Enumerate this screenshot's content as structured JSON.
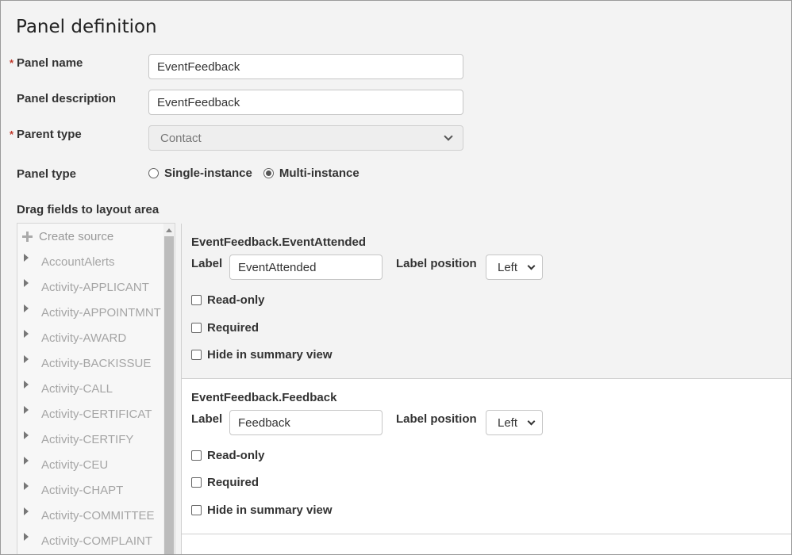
{
  "page": {
    "title": "Panel definition"
  },
  "form": {
    "panel_name": {
      "label": "Panel name",
      "value": "EventFeedback"
    },
    "panel_description": {
      "label": "Panel description",
      "value": "EventFeedback"
    },
    "parent_type": {
      "label": "Parent type",
      "value": "Contact"
    },
    "panel_type": {
      "label": "Panel type",
      "options": [
        {
          "label": "Single-instance",
          "selected": false
        },
        {
          "label": "Multi-instance",
          "selected": true
        }
      ]
    },
    "required_marker": "*"
  },
  "sources": {
    "heading": "Drag fields to layout area",
    "create_label": "Create source",
    "items": [
      "AccountAlerts",
      "Activity-APPLICANT",
      "Activity-APPOINTMNT",
      "Activity-AWARD",
      "Activity-BACKISSUE",
      "Activity-CALL",
      "Activity-CERTIFICAT",
      "Activity-CERTIFY",
      "Activity-CEU",
      "Activity-CHAPT",
      "Activity-COMMITTEE",
      "Activity-COMPLAINT"
    ]
  },
  "layout_fields": [
    {
      "title": "EventFeedback.EventAttended",
      "label_caption": "Label",
      "label_value": "EventAttended",
      "position_caption": "Label position",
      "position_value": "Left",
      "read_only": "Read-only",
      "required": "Required",
      "hide_summary": "Hide in summary view"
    },
    {
      "title": "EventFeedback.Feedback",
      "label_caption": "Label",
      "label_value": "Feedback",
      "position_caption": "Label position",
      "position_value": "Left",
      "read_only": "Read-only",
      "required": "Required",
      "hide_summary": "Hide in summary view"
    }
  ]
}
